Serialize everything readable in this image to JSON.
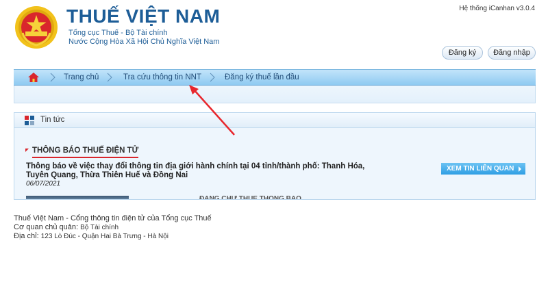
{
  "header": {
    "title": "THUẾ VIỆT NAM",
    "subtitle_line1": "Tổng cục Thuế - Bộ Tài chính",
    "subtitle_line2": "Nước Cộng Hòa Xã Hội Chủ Nghĩa Việt Nam",
    "system_version": "Hệ thống iCanhan v3.0.4",
    "register_label": "Đăng ký",
    "login_label": "Đăng nhập",
    "emblem_text": "THUẾ NHÀ NƯỚC"
  },
  "nav": {
    "home_icon": "home-icon",
    "items": [
      {
        "label": "Trang chủ"
      },
      {
        "label": "Tra cứu thông tin NNT"
      },
      {
        "label": "Đăng ký thuế lần đầu"
      }
    ]
  },
  "news": {
    "heading": "Tin tức",
    "section_title": "THÔNG BÁO THUẾ ĐIỆN TỬ",
    "article": {
      "title": "Thông báo về việc thay đổi thông tin địa giới hành chính tại 04 tỉnh/thành phố: Thanh Hóa, Tuyên Quang, Thừa Thiên Huế và Đồng Nai",
      "date": "06/07/2021"
    },
    "more_button": "XEM TIN LIÊN QUAN",
    "truncated_text": "ĐĂNG CHỮ THUẾ THÔNG BÁO"
  },
  "footer": {
    "site_line": "Thuế Việt Nam - Cổng thông tin điện tử của Tổng cục Thuế",
    "agency_label": "Cơ quan chủ quản:",
    "agency_value": "Bộ Tài chính",
    "address_label": "Địa chỉ:",
    "address_value": "123 Lò Đúc - Quận Hai Bà Trưng - Hà Nội"
  },
  "colors": {
    "brand_blue": "#1d5d97",
    "nav_blue": "#8fcaf1",
    "accent_red": "#d9262c",
    "button_blue": "#2f9ee4"
  }
}
